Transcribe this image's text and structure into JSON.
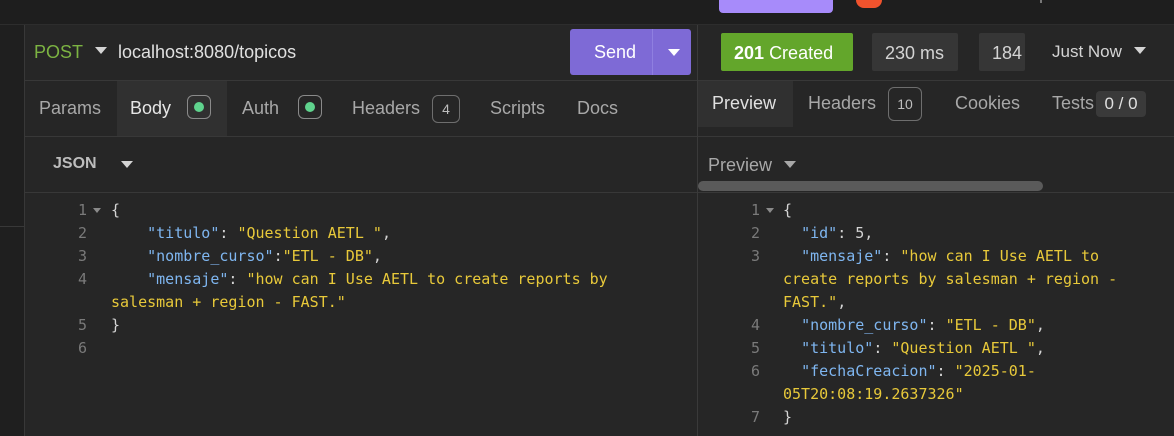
{
  "request": {
    "method": "POST",
    "url": "localhost:8080/topicos",
    "send_label": "Send",
    "tabs": [
      {
        "label": "Params"
      },
      {
        "label": "Body"
      },
      {
        "label": "Auth"
      },
      {
        "label": "Headers",
        "badge": "4"
      },
      {
        "label": "Scripts"
      },
      {
        "label": "Docs"
      }
    ],
    "body_type": "JSON",
    "editor": {
      "line_numbers": [
        "1",
        "2",
        "3",
        "4",
        "",
        "5",
        "6"
      ]
    }
  },
  "response": {
    "status_code": "201",
    "status_text": "Created",
    "time": "230 ms",
    "size": "184",
    "history": "Just Now",
    "tabs": [
      {
        "label": "Preview"
      },
      {
        "label": "Headers",
        "badge": "10"
      },
      {
        "label": "Cookies"
      },
      {
        "label": "Tests",
        "badge": "0 / 0"
      }
    ],
    "preview_label": "Preview",
    "editor": {
      "line_numbers": [
        "1",
        "2",
        "3",
        "",
        "",
        "4",
        "5",
        "6",
        "",
        "7"
      ]
    }
  },
  "colors": {
    "method": "#7cb342",
    "send": "#7e6ad6",
    "status_ok": "#63a62b",
    "json_key": "#7fb6f0",
    "json_string": "#e8c93a",
    "dot_ok": "#5fd38d"
  }
}
